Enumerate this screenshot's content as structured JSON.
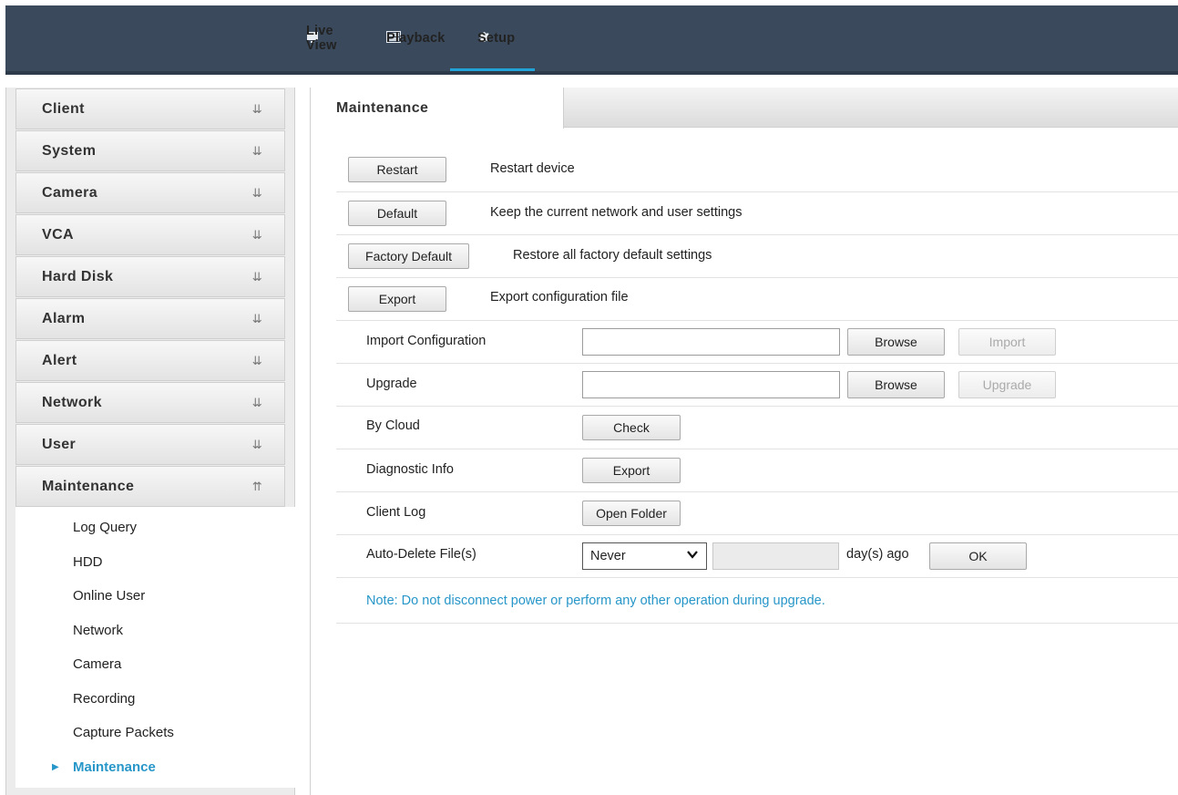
{
  "topnav": {
    "items": [
      {
        "label": "Live View",
        "icon": "monitor-icon"
      },
      {
        "label": "Playback",
        "icon": "film-icon"
      },
      {
        "label": "Setup",
        "icon": "gear-icon",
        "active": true
      }
    ]
  },
  "sidebar": {
    "menus": [
      {
        "label": "Client",
        "icon": "chevron-down-double-icon"
      },
      {
        "label": "System",
        "icon": "chevron-down-double-icon"
      },
      {
        "label": "Camera",
        "icon": "chevron-down-double-icon"
      },
      {
        "label": "VCA",
        "icon": "chevron-down-double-icon"
      },
      {
        "label": "Hard Disk",
        "icon": "chevron-down-double-icon"
      },
      {
        "label": "Alarm",
        "icon": "chevron-down-double-icon"
      },
      {
        "label": "Alert",
        "icon": "chevron-down-double-icon"
      },
      {
        "label": "Network",
        "icon": "chevron-down-double-icon"
      },
      {
        "label": "User",
        "icon": "chevron-down-double-icon"
      },
      {
        "label": "Maintenance",
        "icon": "chevron-up-double-icon",
        "expanded": true
      }
    ],
    "submenu": [
      {
        "label": "Log Query"
      },
      {
        "label": "HDD"
      },
      {
        "label": "Online User"
      },
      {
        "label": "Network"
      },
      {
        "label": "Camera"
      },
      {
        "label": "Recording"
      },
      {
        "label": "Capture Packets"
      },
      {
        "label": "Maintenance",
        "active": true
      }
    ]
  },
  "main": {
    "tab": "Maintenance",
    "actions": [
      {
        "button": "Restart",
        "description": "Restart device"
      },
      {
        "button": "Default",
        "description": "Keep the current network and user settings"
      },
      {
        "button": "Factory Default",
        "description": "Restore all factory default settings"
      },
      {
        "button": "Export",
        "description": "Export configuration file"
      }
    ],
    "import": {
      "label": "Import Configuration",
      "value": "",
      "browse": "Browse",
      "action": "Import"
    },
    "upgrade": {
      "label": "Upgrade",
      "value": "",
      "browse": "Browse",
      "action": "Upgrade"
    },
    "cloud": {
      "label": "By Cloud",
      "button": "Check"
    },
    "diagnostic": {
      "label": "Diagnostic Info",
      "button": "Export"
    },
    "clientlog": {
      "label": "Client Log",
      "button": "Open Folder"
    },
    "autodelete": {
      "label": "Auto-Delete File(s)",
      "selected": "Never",
      "days_value": "",
      "suffix": "day(s) ago",
      "button": "OK"
    },
    "note": "Note: Do not disconnect power or perform any other operation during upgrade."
  },
  "colors": {
    "topbar": "#3a4a5c",
    "accent": "#22a3d8",
    "active_text": "#2796c8"
  }
}
